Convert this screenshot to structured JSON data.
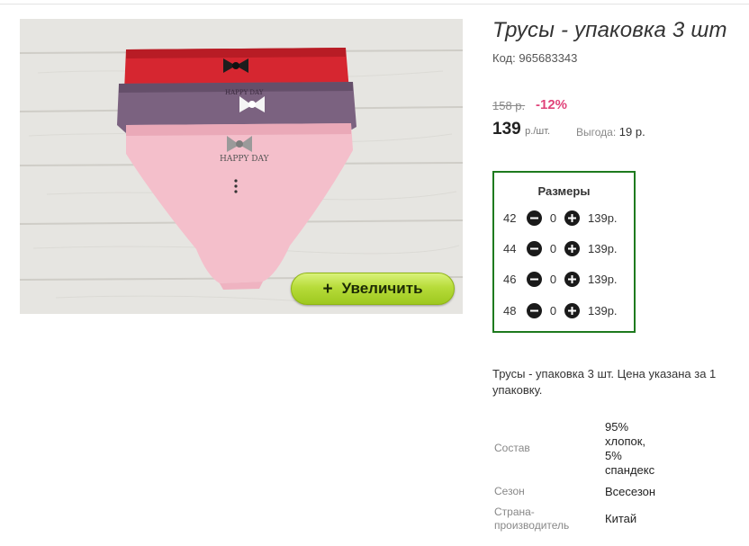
{
  "product": {
    "title": "Трусы - упаковка 3 шт",
    "code": "Код: 965683343"
  },
  "photo": {
    "zoom_label": "Увеличить",
    "zoom_icon": "plus-icon",
    "print_text": "HAPPY DAY"
  },
  "pricing": {
    "old_price": "158 р.",
    "discount": "-12%",
    "price": "139",
    "unit": "р./шт.",
    "saving_label": "Выгода:",
    "saving_value": "19 р."
  },
  "sizes": {
    "title": "Размеры",
    "rows": [
      {
        "size": "42",
        "qty": "0",
        "price": "139р."
      },
      {
        "size": "44",
        "qty": "0",
        "price": "139р."
      },
      {
        "size": "46",
        "qty": "0",
        "price": "139р."
      },
      {
        "size": "48",
        "qty": "0",
        "price": "139р."
      }
    ],
    "accent_color": "#1e7a1e"
  },
  "description": "Трусы - упаковка 3 шт. Цена указана за 1 упаковку.",
  "specs": [
    {
      "label": "Состав",
      "value_lines": [
        "95%",
        "хлопок,",
        "5%",
        "спандекс"
      ]
    },
    {
      "label": "Сезон",
      "value_lines": [
        "Всесезон"
      ]
    },
    {
      "label_lines": [
        "Страна-",
        "производитель"
      ],
      "value_lines": [
        "Китай"
      ]
    }
  ],
  "colors": {
    "discount": "#e0447a",
    "button_green": "#b7dc3a"
  }
}
